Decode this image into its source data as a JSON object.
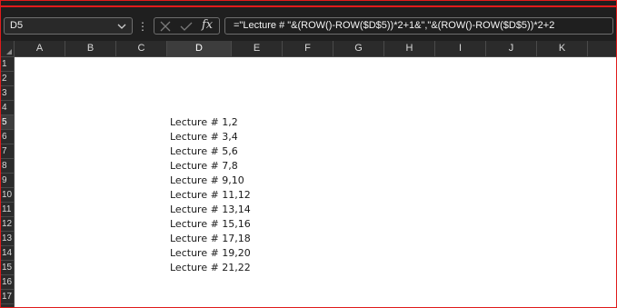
{
  "formula_bar": {
    "name_box": "D5",
    "fx_label": "fx",
    "formula": "=\"Lecture # \"&(ROW()-ROW($D$5))*2+1&\",\"&(ROW()-ROW($D$5))*2+2"
  },
  "columns": [
    "A",
    "B",
    "C",
    "D",
    "E",
    "F",
    "G",
    "H",
    "I",
    "J",
    "K"
  ],
  "selected_column": "D",
  "rows": [
    "1",
    "2",
    "3",
    "4",
    "5",
    "6",
    "7",
    "8",
    "9",
    "10",
    "11",
    "12",
    "13",
    "14",
    "15",
    "16",
    "17"
  ],
  "selected_row": "5",
  "cells_d": [
    {
      "row": "5",
      "value": "Lecture # 1,2"
    },
    {
      "row": "6",
      "value": "Lecture # 3,4"
    },
    {
      "row": "7",
      "value": "Lecture # 5,6"
    },
    {
      "row": "8",
      "value": "Lecture # 7,8"
    },
    {
      "row": "9",
      "value": "Lecture # 9,10"
    },
    {
      "row": "10",
      "value": "Lecture # 11,12"
    },
    {
      "row": "11",
      "value": "Lecture # 13,14"
    },
    {
      "row": "12",
      "value": "Lecture # 15,16"
    },
    {
      "row": "13",
      "value": "Lecture # 17,18"
    },
    {
      "row": "14",
      "value": "Lecture # 19,20"
    },
    {
      "row": "15",
      "value": "Lecture # 21,22"
    }
  ],
  "colors": {
    "border_accent": "#e01b1b",
    "header_bg": "#2b2b2b",
    "toolbar_bg": "#1f1f1f"
  },
  "icons": [
    "chevron-down-icon",
    "more-options-icon",
    "cancel-icon",
    "confirm-icon",
    "insert-function-icon",
    "select-all-icon"
  ]
}
